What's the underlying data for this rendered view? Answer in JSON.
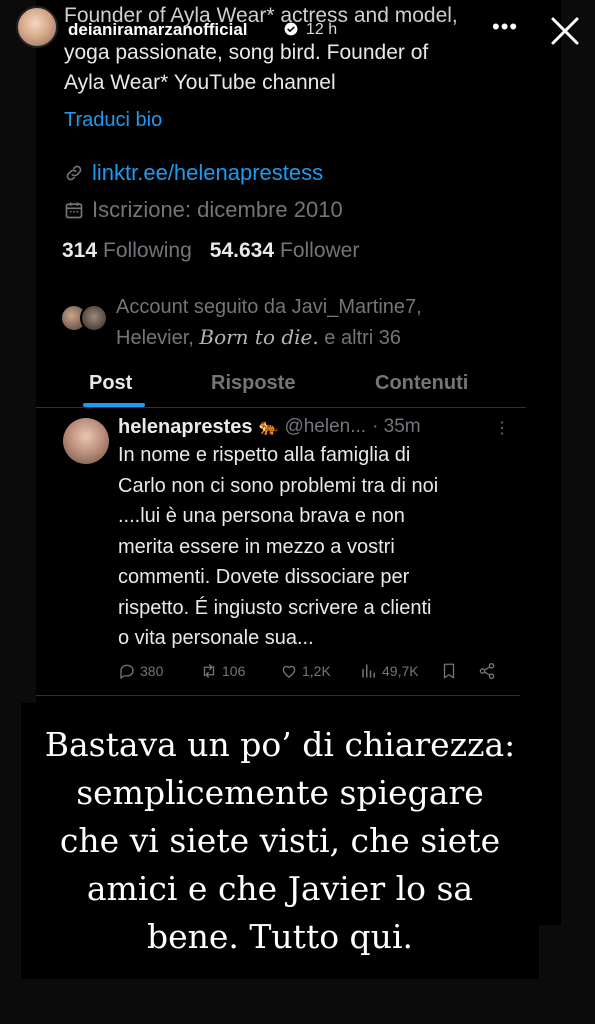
{
  "story": {
    "username": "deianiramarzanofficial",
    "time": "12 h",
    "more_icon": "more-icon",
    "close_icon": "close-icon"
  },
  "profile": {
    "bio_lines": [
      "Founder of Ayla Wear* actress and model,",
      "yoga passionate, song bird. Founder of",
      "Ayla Wear* YouTube channel"
    ],
    "translate_label": "Traduci bio",
    "link": "linktr.ee/helenaprestess",
    "joined": "Iscrizione: dicembre 2010",
    "following_count": "314",
    "following_label": "Following",
    "followers_count": "54.634",
    "followers_label": "Follower",
    "followed_by_1": "Account seguito da Javi_Martine7,",
    "followed_by_2a": "Helevier, ",
    "followed_by_2b": "Born to die.",
    "followed_by_2c": " e altri 36"
  },
  "tabs": [
    {
      "label": "Post",
      "active": true
    },
    {
      "label": "Risposte",
      "active": false
    },
    {
      "label": "Contenuti",
      "active": false
    }
  ],
  "tweet": {
    "name": "helenaprestes",
    "emoji": "🐅",
    "handle": "@helen...",
    "time": "· 35m",
    "body_lines": [
      "In nome e rispetto alla famiglia di",
      "Carlo non ci sono problemi tra di noi",
      "....lui è una persona brava e non",
      "merita essere in mezzo a vostri",
      "commenti. Dovete dissociare per",
      "rispetto. É ingiusto scrivere a clienti",
      "o vita personale sua..."
    ],
    "replies": "380",
    "reposts": "106",
    "likes": "1,2K",
    "views": "49,7K"
  },
  "caption": {
    "lines": [
      "Bastava un po’ di chiarezza:",
      "semplicemente spiegare",
      "che vi siete visti, che siete",
      "amici e che Javier lo sa",
      "bene. Tutto qui."
    ]
  },
  "colors": {
    "link_blue": "#1d9bf0",
    "muted_gray": "#71767b",
    "text": "#e7e9ea",
    "background": "#000000"
  }
}
